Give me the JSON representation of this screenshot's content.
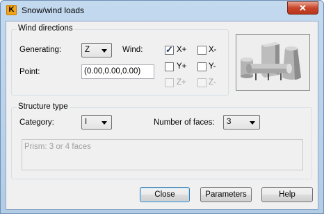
{
  "window": {
    "title": "Snow/wind loads",
    "app_icon_letter": "K",
    "close_glyph": "✕"
  },
  "wind_directions": {
    "group_label": "Wind directions",
    "generating_label": "Generating:",
    "generating_value": "Z",
    "wind_label": "Wind:",
    "point_label": "Point:",
    "point_value": "(0.00,0.00,0.00)",
    "checkboxes": [
      {
        "label": "X+",
        "checked": true,
        "enabled": true
      },
      {
        "label": "X-",
        "checked": false,
        "enabled": true
      },
      {
        "label": "Y+",
        "checked": false,
        "enabled": true
      },
      {
        "label": "Y-",
        "checked": false,
        "enabled": true
      },
      {
        "label": "Z+",
        "checked": false,
        "enabled": false
      },
      {
        "label": "Z-",
        "checked": false,
        "enabled": false
      }
    ]
  },
  "structure_type": {
    "group_label": "Structure type",
    "category_label": "Category:",
    "category_value": "I",
    "faces_label": "Number of faces:",
    "faces_value": "3",
    "description": "Prism: 3 or 4 faces"
  },
  "buttons": {
    "close": "Close",
    "parameters": "Parameters",
    "help": "Help"
  },
  "check_glyph": "✓"
}
